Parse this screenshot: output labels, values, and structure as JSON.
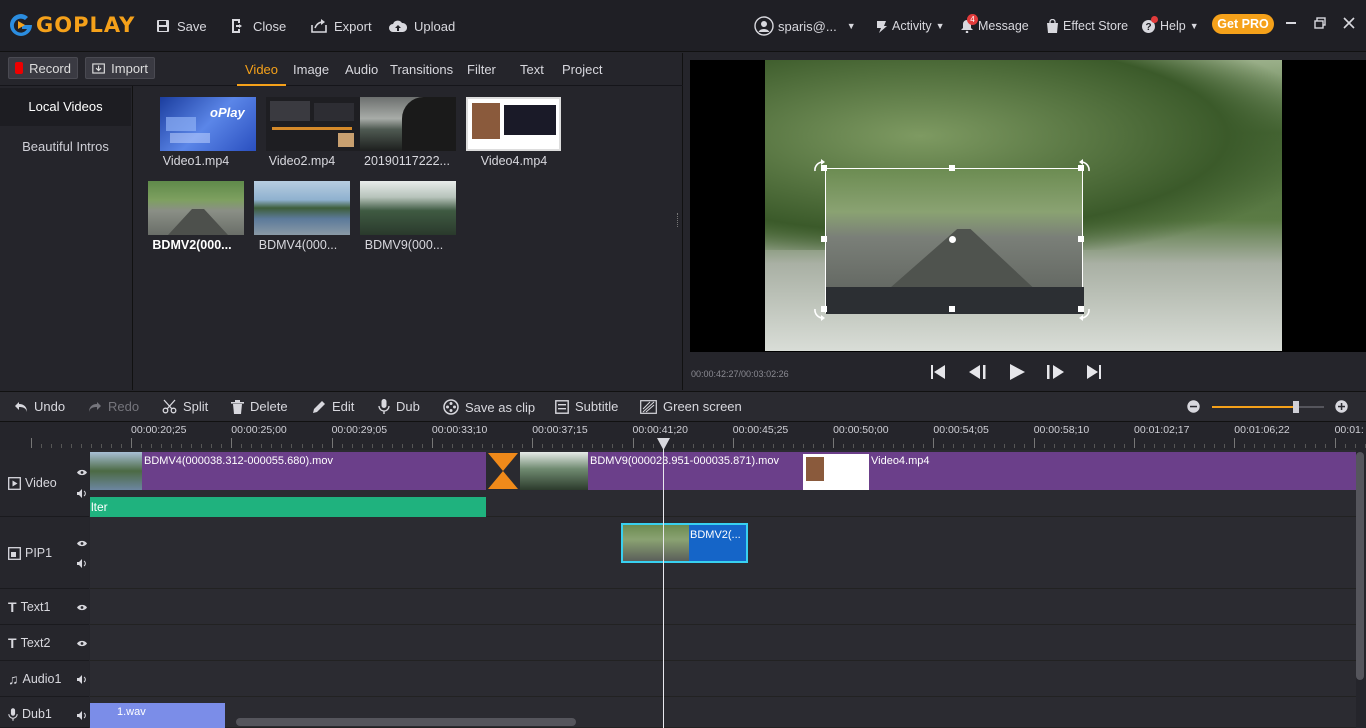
{
  "app": {
    "logo_text": "GOPLAY"
  },
  "top_toolbar": {
    "save": "Save",
    "close": "Close",
    "export": "Export",
    "upload": "Upload"
  },
  "account": {
    "user": "sparis@...",
    "activity": "Activity",
    "message": "Message",
    "message_badge": "4",
    "effect_store": "Effect Store",
    "help": "Help",
    "get_pro": "Get PRO"
  },
  "media": {
    "record": "Record",
    "import": "Import",
    "tabs": [
      "Video",
      "Image",
      "Audio",
      "Transitions",
      "Filter",
      "Text",
      "Project"
    ],
    "active_tab": "Video",
    "side": [
      "Local Videos",
      "Beautiful Intros"
    ],
    "items": [
      "Video1.mp4",
      "Video2.mp4",
      "20190117222...",
      "Video4.mp4",
      "BDMV2(000...",
      "BDMV4(000...",
      "BDMV9(000..."
    ]
  },
  "player": {
    "time": "00:00:42:27/00:03:02:26"
  },
  "edit_toolbar": {
    "undo": "Undo",
    "redo": "Redo",
    "split": "Split",
    "delete": "Delete",
    "edit": "Edit",
    "dub": "Dub",
    "save_as_clip": "Save as clip",
    "subtitle": "Subtitle",
    "green_screen": "Green screen",
    "zoom_level": 0.75
  },
  "timeline": {
    "ruler": [
      "00:00:20;25",
      "00:00:25;00",
      "00:00:29;05",
      "00:00:33;10",
      "00:00:37;15",
      "00:00:41;20",
      "00:00:45;25",
      "00:00:50;00",
      "00:00:54;05",
      "00:00:58;10",
      "00:01:02;17",
      "00:01:06;22",
      "00:01:"
    ],
    "tracks": [
      "Video",
      "PIP1",
      "Text1",
      "Text2",
      "Audio1",
      "Dub1"
    ],
    "clips": {
      "video1": "BDMV4(000038.312-000055.680).mov",
      "video2": "BDMV9(000023.951-000035.871).mov",
      "video3": "Video4.mp4",
      "filter": "lter",
      "pip": "BDMV2(...",
      "dub": "1.wav"
    }
  },
  "colors": {
    "accent": "#f5a11a",
    "video_track": "#6b3f8a",
    "filter": "#1fb27e",
    "pip": "#1565c8",
    "dub": "#7b8de8"
  }
}
